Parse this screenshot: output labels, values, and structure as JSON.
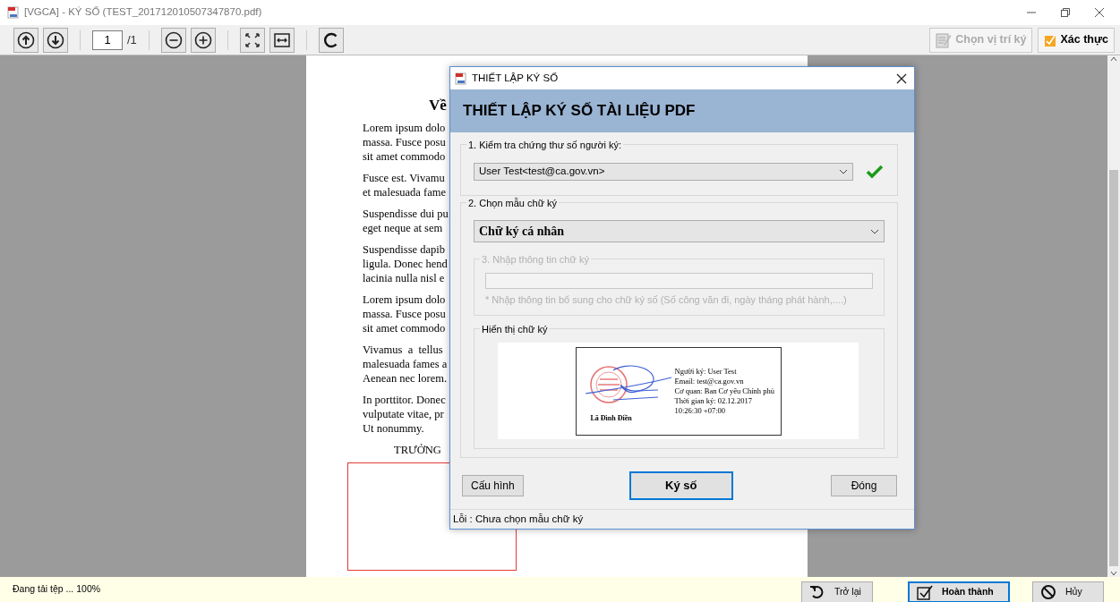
{
  "window": {
    "title": "[VGCA] - KÝ SỐ (TEST_201712010507347870.pdf)"
  },
  "toolbar": {
    "page_value": "1",
    "page_total": "/1",
    "actions": [
      {
        "label": "Chọn vị trí ký",
        "disabled": true
      },
      {
        "label": "Xác thực",
        "disabled": false
      }
    ]
  },
  "document": {
    "heading": "Về",
    "paragraphs": [
      [
        "Lorem ipsum dolo",
        "massa. Fusce posu",
        "sit amet commodo"
      ],
      [
        "Fusce est. Vivamu",
        "et malesuada fame"
      ],
      [
        "Suspendisse dui pu",
        "eget neque at sem"
      ],
      [
        "Suspendisse dapib",
        "ligula. Donec hend",
        "lacinia nulla nisl e"
      ],
      [
        "Lorem ipsum dolo",
        "massa. Fusce posu",
        "sit amet commodo"
      ],
      [
        "Vivamus  a  tellus",
        "malesuada fames a",
        "Aenean nec lorem."
      ],
      [
        "In porttitor. Donec",
        "vulputate vitae, pr",
        "Ut nonummy."
      ]
    ],
    "signer_title": "TRƯỞNG"
  },
  "dialog": {
    "title": "THIẾT LẬP KÝ SỐ",
    "header": "THIẾT LẬP KÝ SỐ TÀI LIỆU PDF",
    "certificate": {
      "legend": "1. Kiểm tra chứng thư số người ký:",
      "value": "User Test<test@ca.gov.vn>",
      "verified": true
    },
    "template": {
      "legend": "2. Chọn mẫu chữ ký",
      "value": "Chữ ký cá nhân"
    },
    "info": {
      "legend": "3. Nhập thông tin chữ ký",
      "hint": "* Nhập thông tin bổ sung cho chữ ký số (Số công văn đi, ngày tháng phát hành,....)",
      "disabled": true
    },
    "preview": {
      "legend": "Hiển thị chữ ký",
      "signer_name": "Lã Đình Điền",
      "lines": [
        "Người ký: User Test",
        "Email: test@ca.gov.vn",
        "Cơ quan: Ban Cơ yếu Chính phủ",
        "Thời gian ký: 02.12.2017",
        "10:26:30 +07:00"
      ]
    },
    "buttons": [
      {
        "label": "Cấu hình",
        "selected": false
      },
      {
        "label": "Ký số",
        "selected": true
      },
      {
        "label": "Đóng",
        "selected": false
      }
    ],
    "status": "Lỗi : Chưa chọn mẫu chữ ký"
  },
  "status_bar": {
    "text": "Đang tải tệp ... 100%",
    "buttons": [
      {
        "kind": "back",
        "label": "Trở lại",
        "selected": false
      },
      {
        "kind": "done",
        "label": "Hoàn thành",
        "selected": true
      },
      {
        "kind": "cancel",
        "label": "Hủy",
        "selected": false
      }
    ]
  }
}
